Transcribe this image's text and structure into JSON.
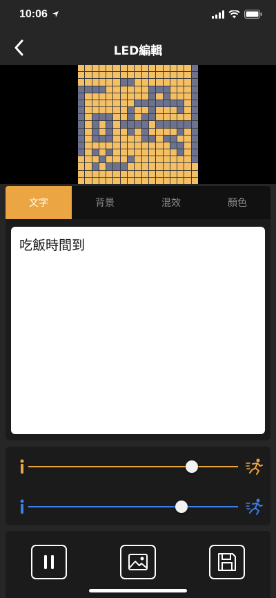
{
  "status_bar": {
    "time": "10:06"
  },
  "nav": {
    "title": "LED編輯"
  },
  "led_preview": {
    "rows": [
      "00000000000000001",
      "00000000000000001",
      "00000011000000001",
      "11110000001110001",
      "10000000001010001",
      "10000000111111101",
      "10000001001000101",
      "10111001011000001",
      "10101011110111111",
      "10101001010000101",
      "10111000011011001",
      "10000000000001101",
      "10101000000000101",
      "00010001000000001",
      "00101110000000000",
      "00000000000000000",
      "00000000000000000"
    ],
    "on_color": "#6c7290",
    "off_color": "#f5c063"
  },
  "tabs": [
    {
      "label": "文字",
      "active": true
    },
    {
      "label": "背景",
      "active": false
    },
    {
      "label": "混效",
      "active": false
    },
    {
      "label": "顏色",
      "active": false
    }
  ],
  "text_input": {
    "value": "吃飯時間到"
  },
  "sliders": [
    {
      "name": "speed",
      "value_percent": 78,
      "color": "#eba542"
    },
    {
      "name": "blink",
      "value_percent": 73,
      "color": "#3d7fe8"
    }
  ],
  "actions": {
    "icons": [
      "pause-icon",
      "image-icon",
      "save-icon"
    ]
  },
  "colors": {
    "accent": "#eba542",
    "blue": "#3d7fe8"
  }
}
